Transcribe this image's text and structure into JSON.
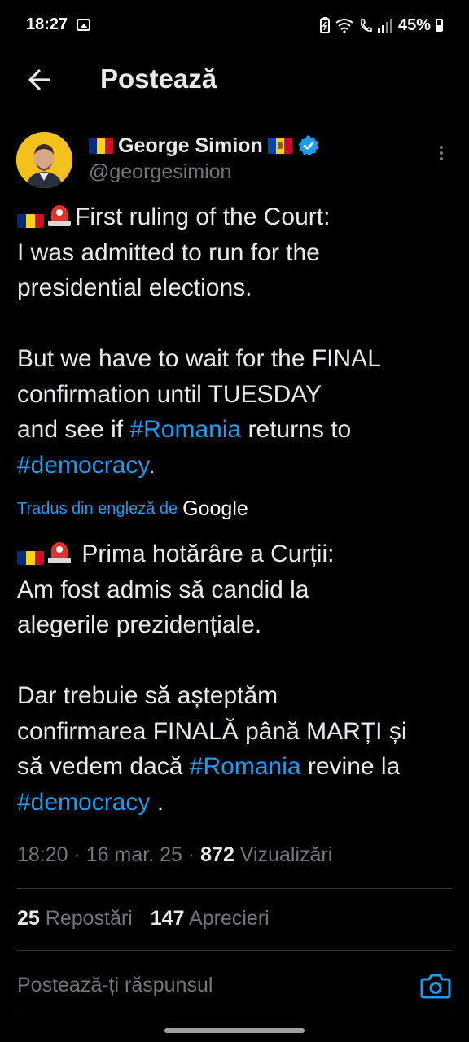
{
  "status_bar": {
    "time": "18:27",
    "battery": "45%"
  },
  "header": {
    "title": "Postează"
  },
  "author": {
    "name": "George Simion",
    "handle": "@georgesimion",
    "avatar_bg": "#f2c21a",
    "verified_color": "#1d9bf0"
  },
  "post": {
    "original": {
      "line1": "First ruling of the Court:",
      "line2": "I was admitted to run for the",
      "line3": "presidential elections.",
      "line4": "But we have to wait for the FINAL",
      "line5": "confirmation until TUESDAY",
      "line6_pre": "and see if ",
      "line6_tag": "#Romania",
      "line6_post": " returns to",
      "line7_tag": "#democracy",
      "line7_post": "."
    },
    "translation_label": "Tradus din engleză de",
    "translation_provider": "Google",
    "translated": {
      "line1": " Prima hotărâre a Curții:",
      "line2": "Am fost admis să candid la",
      "line3": "alegerile prezidențiale.",
      "line4": "Dar trebuie să așteptăm",
      "line5": "confirmarea FINALĂ până MARȚI și",
      "line6_pre": "să vedem dacă ",
      "line6_tag": "#Romania",
      "line6_post": " revine la",
      "line7_tag": "#democracy",
      "line7_post": " ."
    }
  },
  "meta": {
    "time": "18:20",
    "sep1": " · ",
    "date": "16 mar. 25",
    "sep2": " · ",
    "views": "872",
    "views_label": " Vizualizări"
  },
  "stats": {
    "reposts": "25",
    "reposts_label": " Repostări",
    "likes": "147",
    "likes_label": " Aprecieri"
  },
  "reply": {
    "placeholder": "Postează-ți răspunsul"
  },
  "colors": {
    "accent": "#1d9bf0",
    "muted": "#71767b",
    "text": "#e7e9ea",
    "background": "#000000"
  }
}
